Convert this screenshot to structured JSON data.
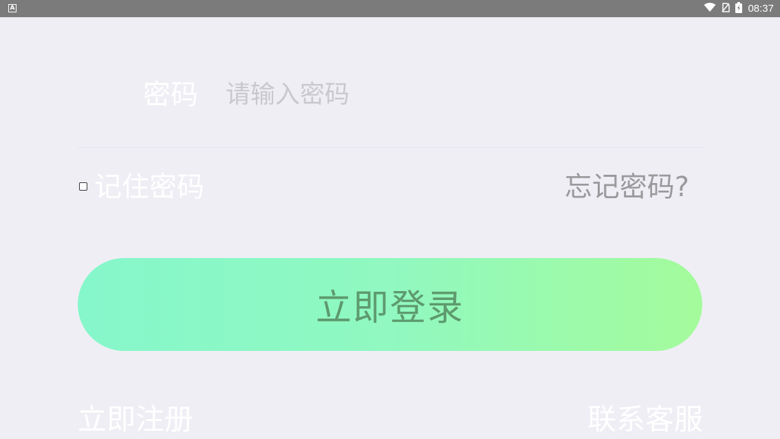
{
  "status_bar": {
    "left_icon_letter": "A",
    "time": "08:37",
    "icons": [
      "wifi-icon",
      "no-sim-icon",
      "battery-charging-icon"
    ]
  },
  "login_form": {
    "password_label": "密码",
    "password_placeholder": "请输入密码",
    "password_value": "",
    "remember_password_label": "记住密码",
    "remember_password_checked": false,
    "forgot_password_link": "忘记密码?",
    "login_button_label": "立即登录",
    "register_link": "立即注册",
    "contact_support_link": "联系客服"
  },
  "colors": {
    "background": "#efeef5",
    "status_bar": "#7b7b7b",
    "button_gradient_start": "#86f7cb",
    "button_gradient_end": "#a4fb9b",
    "button_text": "#5e9a6e",
    "muted_text": "#9a9a9c",
    "placeholder_text": "#c9c9cd"
  }
}
